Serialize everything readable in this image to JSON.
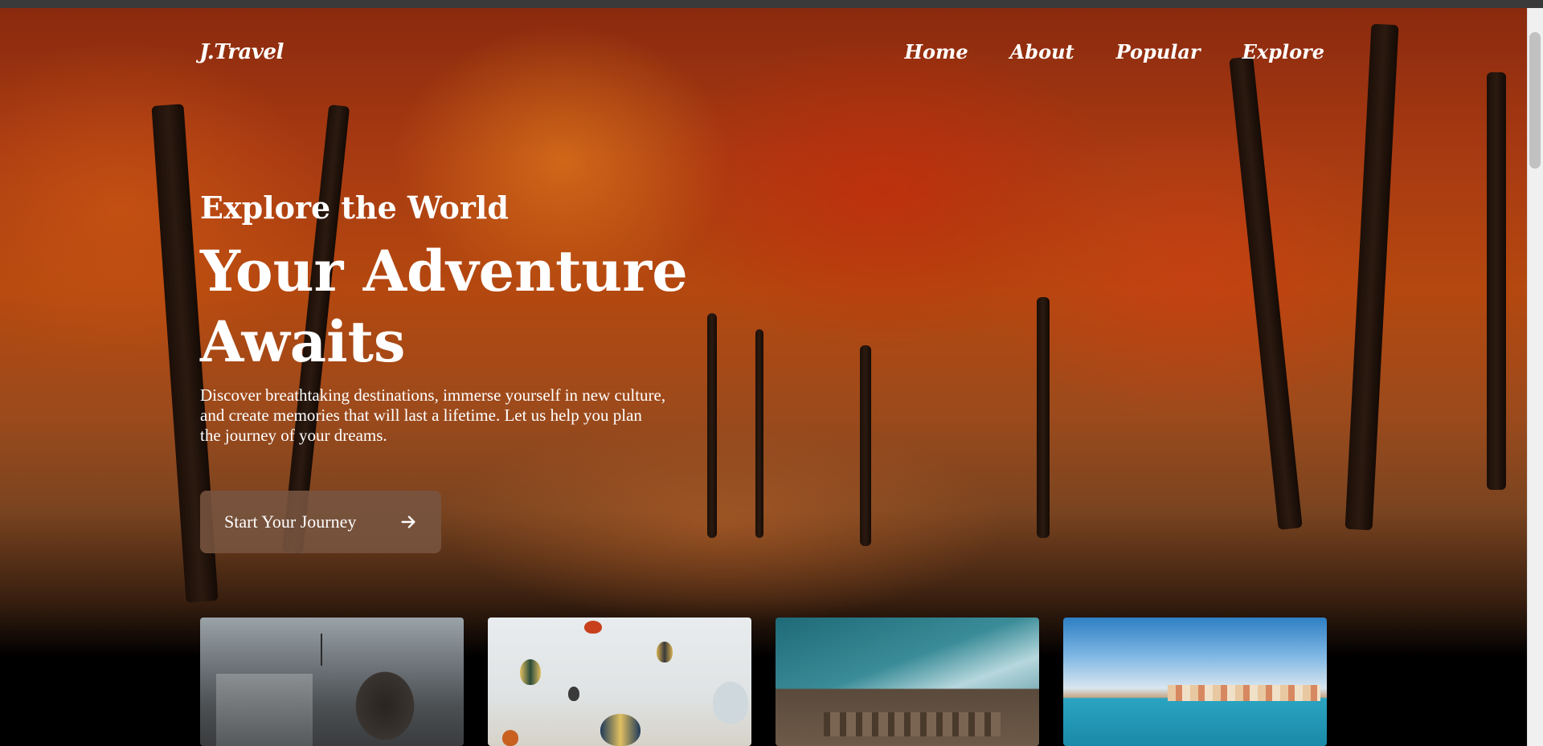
{
  "nav": {
    "logo": "J.Travel",
    "links": [
      "Home",
      "About",
      "Popular",
      "Explore"
    ]
  },
  "hero": {
    "eyebrow": "Explore the World",
    "headline_line1": "Your Adventure",
    "headline_line2": "Awaits",
    "subtext": "Discover breathtaking destinations, immerse yourself in new culture, and create memories that will last a lifetime. Let us help you plan the journey of your dreams.",
    "cta_label": "Start Your Journey",
    "cta_icon": "arrow-right-icon"
  },
  "cards": [
    {
      "icon": "madrid-city-photo"
    },
    {
      "icon": "hot-air-balloons-photo"
    },
    {
      "icon": "colosseum-photo"
    },
    {
      "icon": "coastal-town-photo"
    }
  ],
  "colors": {
    "cta_bg": "#785440",
    "text": "#ffffff"
  }
}
